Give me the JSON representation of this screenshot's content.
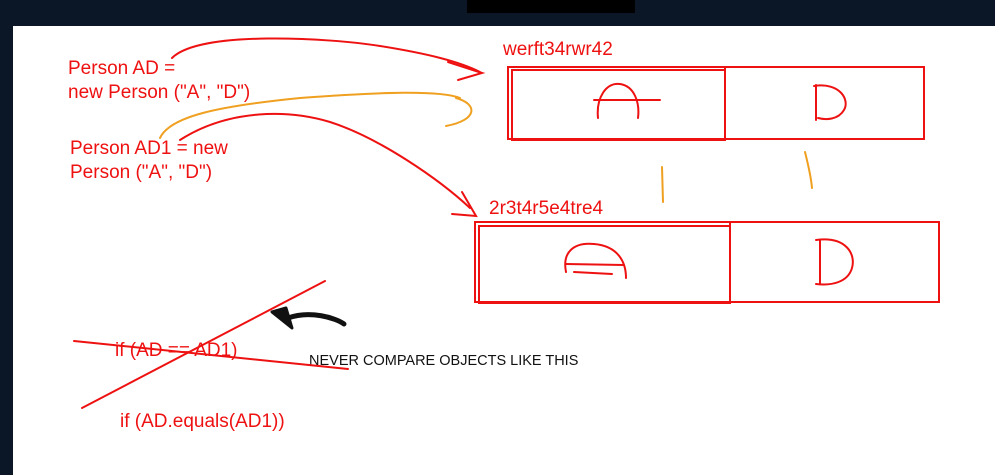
{
  "colors": {
    "ink_red": "#ee1111",
    "ink_orange": "#f0a020",
    "ink_black": "#111111",
    "frame": "#0b1726",
    "canvas": "#ffffff"
  },
  "code": {
    "line1": "Person AD =",
    "line2": "new Person (\"A\", \"D\")",
    "line3": "Person AD1 = new",
    "line4": "Person (\"A\", \"D\")",
    "compare_wrong": "if (AD == AD1)",
    "compare_right": "if (AD.equals(AD1))"
  },
  "memory": {
    "address1": "werft34rwr42",
    "address2": "2r3t4r5e4tre4",
    "obj1_field1": "A",
    "obj1_field2": "D",
    "obj2_field1": "A",
    "obj2_field2": "D"
  },
  "note": "NEVER COMPARE OBJECTS LIKE THIS"
}
